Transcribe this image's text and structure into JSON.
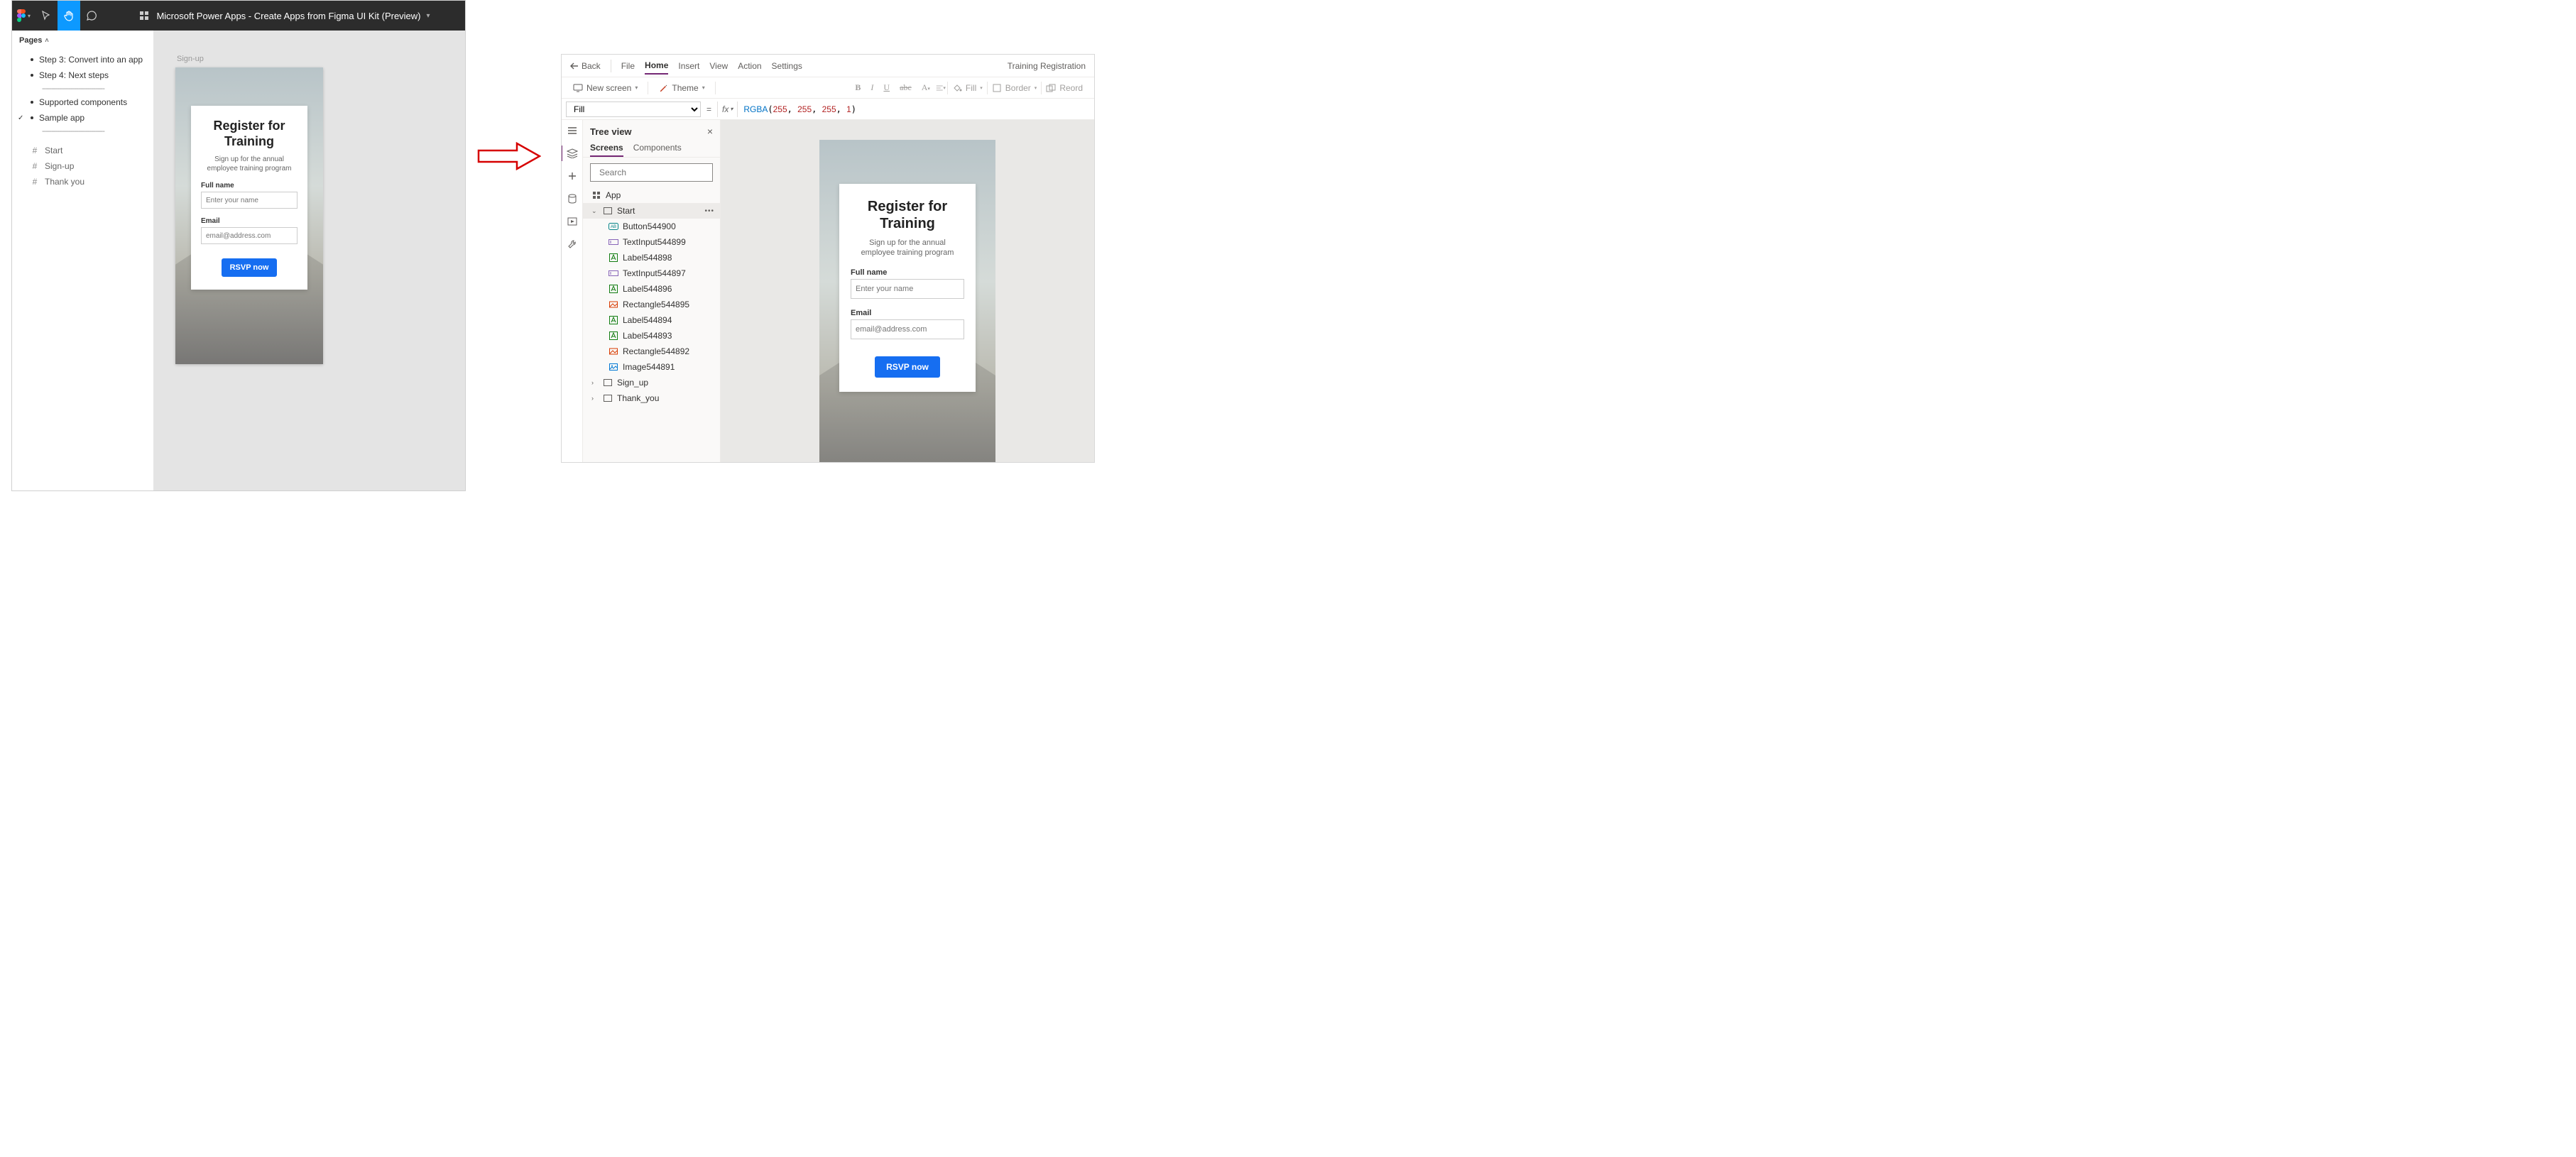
{
  "figma": {
    "title": "Microsoft Power Apps - Create Apps from Figma UI Kit (Preview)",
    "pages_label": "Pages",
    "pages": {
      "step3": "Step 3: Convert into an app",
      "step4": "Step 4: Next steps",
      "supported": "Supported components",
      "sample": "Sample app"
    },
    "frames": {
      "start": "Start",
      "signup": "Sign-up",
      "thankyou": "Thank you"
    },
    "canvas_frame_label": "Sign-up"
  },
  "mock": {
    "heading_l1": "Register for",
    "heading_l2": "Training",
    "sub_l1": "Sign up for the annual",
    "sub_l2": "employee training program",
    "fullname_label": "Full name",
    "fullname_placeholder": "Enter your name",
    "email_label": "Email",
    "email_placeholder": "email@address.com",
    "button": "RSVP now"
  },
  "pa": {
    "cmd": {
      "back": "Back",
      "file": "File",
      "home": "Home",
      "insert": "Insert",
      "view": "View",
      "action": "Action",
      "settings": "Settings",
      "app_title": "Training Registration"
    },
    "ribbon": {
      "new_screen": "New screen",
      "theme": "Theme",
      "fill": "Fill",
      "border": "Border",
      "reord": "Reord"
    },
    "formula": {
      "property": "Fill",
      "fx": "fx",
      "fn": "RGBA",
      "args": [
        "255",
        "255",
        "255",
        "1"
      ]
    },
    "tree": {
      "title": "Tree view",
      "tab_screens": "Screens",
      "tab_components": "Components",
      "search_placeholder": "Search",
      "app": "App",
      "screens": {
        "start": "Start",
        "signup": "Sign_up",
        "thankyou": "Thank_you"
      },
      "controls": [
        "Button544900",
        "TextInput544899",
        "Label544898",
        "TextInput544897",
        "Label544896",
        "Rectangle544895",
        "Label544894",
        "Label544893",
        "Rectangle544892",
        "Image544891"
      ]
    }
  }
}
